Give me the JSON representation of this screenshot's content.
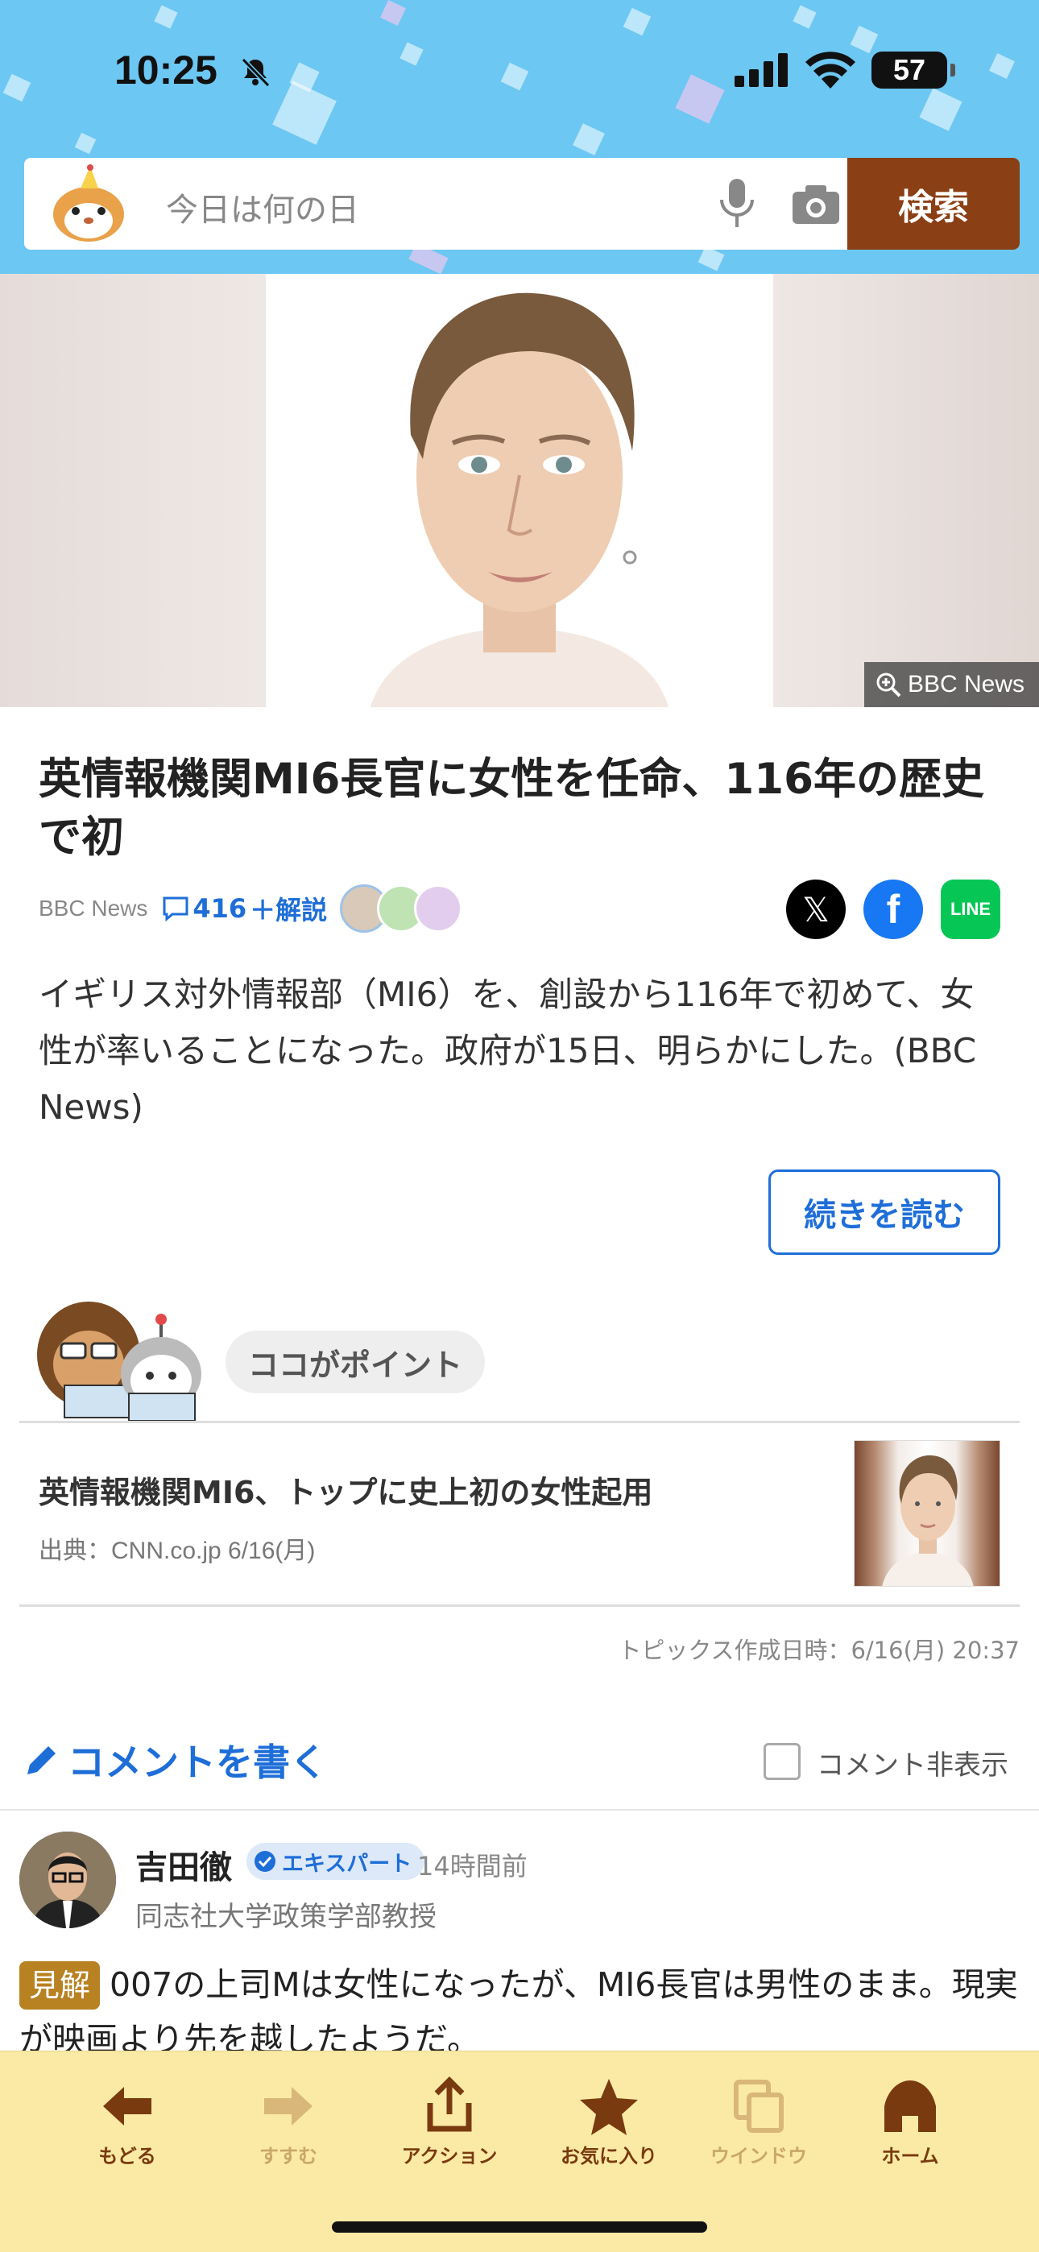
{
  "status_bar": {
    "time": "10:25",
    "battery": "57"
  },
  "search": {
    "placeholder": "今日は何の日",
    "button_label": "検索"
  },
  "hero": {
    "credit": "BBC News"
  },
  "article": {
    "title": "英情報機関MI6長官に女性を任命、116年の歴史で初",
    "source": "BBC News",
    "comment_count": "416",
    "comment_suffix": "＋解説",
    "summary": "イギリス対外情報部（MI6）を、創設から116年で初めて、女性が率いることになった。政府が15日、明らかにした。(BBC News)",
    "read_more_label": "続きを読む",
    "share": {
      "line_label": "LINE"
    }
  },
  "point": {
    "bubble_label": "ココがポイント",
    "title": "英情報機関MI6、トップに史上初の女性起用",
    "source": "出典：CNN.co.jp 6/16(月)",
    "created": "トピックス作成日時：6/16(月) 20:37"
  },
  "comments": {
    "write_label": "コメントを書く",
    "hide_label": "コメント非表示",
    "items": [
      {
        "name": "吉田徹",
        "badge": "エキスパート",
        "time": "14時間前",
        "role": "同志社大学政策学部教授",
        "tag": "見解",
        "text": "007の上司Mは女性になったが、MI6長官は男性のまま。現実が映画より先を越したようだ。"
      }
    ]
  },
  "toolbar": {
    "items": [
      {
        "label": "もどる",
        "icon": "back-arrow-icon"
      },
      {
        "label": "すすむ",
        "icon": "forward-arrow-icon"
      },
      {
        "label": "アクション",
        "icon": "share-icon"
      },
      {
        "label": "お気に入り",
        "icon": "star-icon"
      },
      {
        "label": "ウインドウ",
        "icon": "windows-icon"
      },
      {
        "label": "ホーム",
        "icon": "home-icon"
      }
    ]
  },
  "colors": {
    "header_bg": "#6cc7f2",
    "search_button": "#8a3f14",
    "link_blue": "#1e6ed8",
    "toolbar_bg": "#fbeaa6",
    "toolbar_icon": "#7a3a0f"
  }
}
